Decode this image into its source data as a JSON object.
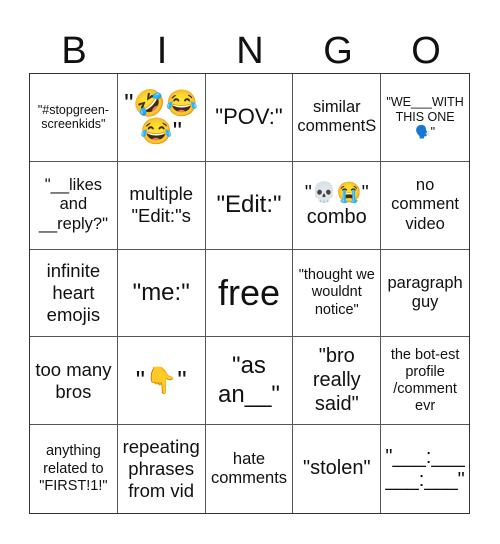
{
  "header": {
    "letters": [
      "B",
      "I",
      "N",
      "G",
      "O"
    ]
  },
  "board": {
    "rows": [
      [
        {
          "text": "\"#stopgreen-screenkids\"",
          "icon": null
        },
        {
          "text": "\"🤣😂😂\"",
          "icon": "laughing-emoji-icons"
        },
        {
          "text": "\"POV:\"",
          "icon": null
        },
        {
          "text": "similar commentS",
          "icon": null
        },
        {
          "text": "\"WE___WITH THIS ONE 🗣️\"",
          "icon": "speaking-head-icon"
        }
      ],
      [
        {
          "text": "\"__likes and __reply?\"",
          "icon": null
        },
        {
          "text": "multiple \"Edit:\"s",
          "icon": null
        },
        {
          "text": "\"Edit:\"",
          "icon": null
        },
        {
          "text": "\"💀😭\" combo",
          "icon": "skull-crying-emoji-icons"
        },
        {
          "text": "no comment video",
          "icon": null
        }
      ],
      [
        {
          "text": "infinite heart emojis",
          "icon": null
        },
        {
          "text": "\"me:\"",
          "icon": null
        },
        {
          "text": "free",
          "icon": null
        },
        {
          "text": "\"thought we wouldnt notice\"",
          "icon": null
        },
        {
          "text": "paragraph guy",
          "icon": null
        }
      ],
      [
        {
          "text": "too many bros",
          "icon": null
        },
        {
          "text": "\"👇\"",
          "icon": "pointing-down-hand-icon"
        },
        {
          "text": "\"as an__\"",
          "icon": null
        },
        {
          "text": "\"bro really said\"",
          "icon": null
        },
        {
          "text": "the bot-est profile /comment evr",
          "icon": null
        }
      ],
      [
        {
          "text": "anything related to \"FIRST!1!\"",
          "icon": null
        },
        {
          "text": "repeating phrases from vid",
          "icon": null
        },
        {
          "text": "hate comments",
          "icon": null
        },
        {
          "text": "\"stolen\"",
          "icon": null
        },
        {
          "text": "\"___:___ ___:___\"",
          "icon": null
        }
      ]
    ]
  }
}
